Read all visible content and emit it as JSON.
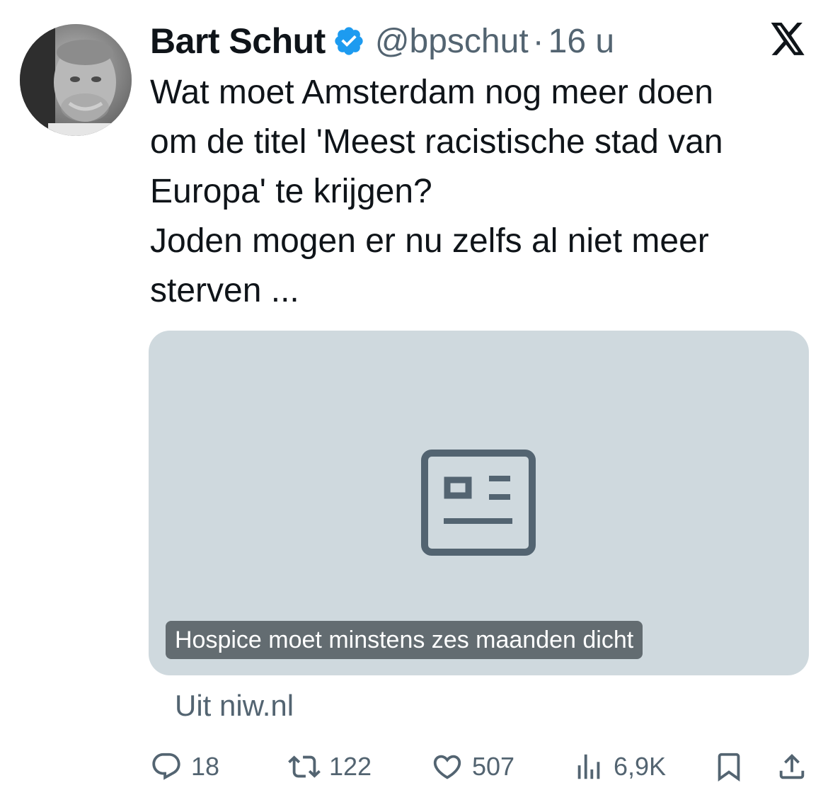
{
  "tweet": {
    "display_name": "Bart Schut",
    "handle": "@bpschut",
    "separator": "·",
    "time": "16 u",
    "text": "Wat moet Amsterdam nog meer doen\nom de titel 'Meest racistische stad van\nEuropa' te krijgen?\nJoden mogen er nu zelfs al niet meer\nsterven ..."
  },
  "card": {
    "caption": "Hospice moet minstens zes maanden dicht",
    "source": "Uit niw.nl",
    "icon": "news-article-icon"
  },
  "actions": {
    "replies": "18",
    "retweets": "122",
    "likes": "507",
    "views": "6,9K"
  },
  "icons": {
    "verified": "verified-badge-icon",
    "platform": "x-logo-icon",
    "reply": "reply-icon",
    "retweet": "retweet-icon",
    "like": "heart-icon",
    "views": "views-chart-icon",
    "bookmark": "bookmark-icon",
    "share": "share-icon"
  },
  "colors": {
    "text": "#0f1419",
    "secondary": "#536471",
    "verified": "#1d9bf0",
    "card_bg": "#cfd9de"
  }
}
